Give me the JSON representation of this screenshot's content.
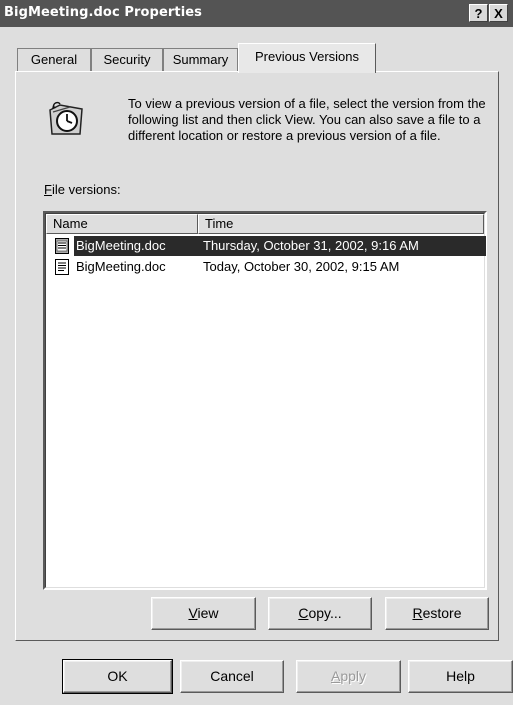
{
  "window": {
    "title": "BigMeeting.doc Properties",
    "help_label": "?",
    "close_label": "X"
  },
  "tabs": [
    {
      "label": "General"
    },
    {
      "label": "Security"
    },
    {
      "label": "Summary"
    },
    {
      "label": "Previous Versions",
      "active": true
    }
  ],
  "info": {
    "icon": "clock-folder-icon",
    "text": "To view a previous version of a file, select the version from the following list and then click View.  You can also save a file to a different location or restore a previous version of a file."
  },
  "versions": {
    "label_mnemonic": "F",
    "label_rest": "ile versions:",
    "columns": {
      "name": "Name",
      "time": "Time"
    },
    "rows": [
      {
        "name": "BigMeeting.doc",
        "time": "Thursday, October 31, 2002, 9:16 AM",
        "selected": true
      },
      {
        "name": "BigMeeting.doc",
        "time": "Today, October 30, 2002, 9:15 AM",
        "selected": false
      }
    ]
  },
  "actions": {
    "view_mnemonic": "V",
    "view_rest": "iew",
    "copy_mnemonic": "C",
    "copy_rest": "opy...",
    "restore_mnemonic": "R",
    "restore_rest": "estore"
  },
  "footer": {
    "ok": "OK",
    "cancel": "Cancel",
    "apply_mnemonic": "A",
    "apply_rest": "pply",
    "help": "Help"
  }
}
